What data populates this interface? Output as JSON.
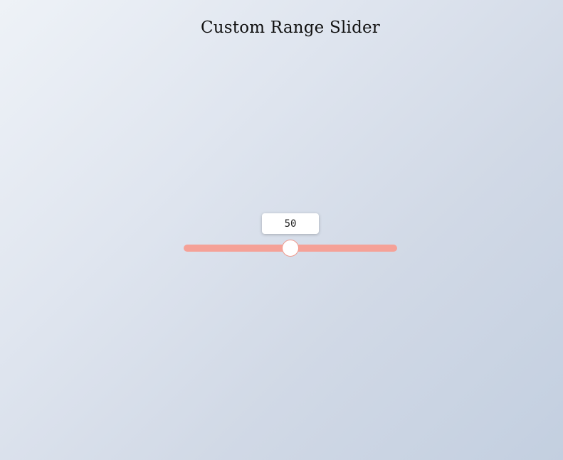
{
  "page": {
    "title": "Custom Range Slider"
  },
  "slider": {
    "value": 50,
    "value_label": "50",
    "min": 0,
    "max": 100,
    "track_color": "#f5a197",
    "thumb_color": "#ffffff",
    "thumb_border_color": "#f09a8e"
  }
}
